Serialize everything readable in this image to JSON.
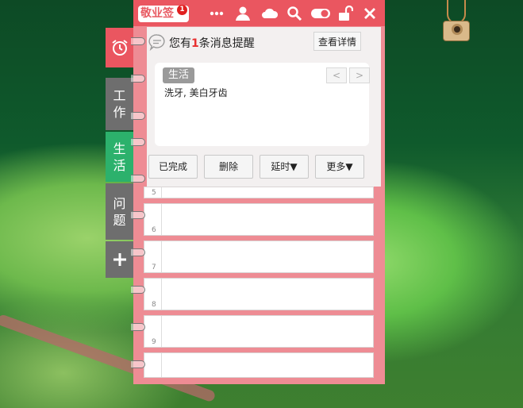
{
  "app": {
    "logo_text": "敬业签",
    "logo_badge": "1"
  },
  "toolbar": {
    "icons": [
      "more-icon",
      "user-icon",
      "cloud-icon",
      "search-icon",
      "toggle-icon",
      "unlock-icon",
      "close-icon"
    ]
  },
  "side_tabs": [
    {
      "label": "",
      "icon": "alarm-clock-icon",
      "color": "#ea5660"
    },
    {
      "label": "工作",
      "color": "#6e6e6e"
    },
    {
      "label": "生活",
      "color": "#2cb16c"
    },
    {
      "label": "问题",
      "color": "#6e6e6e"
    },
    {
      "label": "",
      "icon": "plus-icon",
      "color": "#6e6e6e"
    }
  ],
  "reminder": {
    "prefix": "您有",
    "count": "1",
    "suffix": "条消息提醒",
    "detail_button": "查看详情"
  },
  "note": {
    "tag": "生活",
    "content": "洗牙, 美白牙齿",
    "prev": "<",
    "next": ">"
  },
  "actions": {
    "done": "已完成",
    "delete": "删除",
    "postpone": "延时▼",
    "more": "更多▼"
  },
  "rows": [
    {
      "number": "5"
    },
    {
      "number": "6"
    },
    {
      "number": "7"
    },
    {
      "number": "8"
    },
    {
      "number": "9"
    },
    {
      "number": ""
    }
  ],
  "colors": {
    "accent": "#ea5660",
    "panel": "#ee8c94",
    "tab_active": "#2cb16c",
    "tab_inactive": "#6e6e6e"
  }
}
